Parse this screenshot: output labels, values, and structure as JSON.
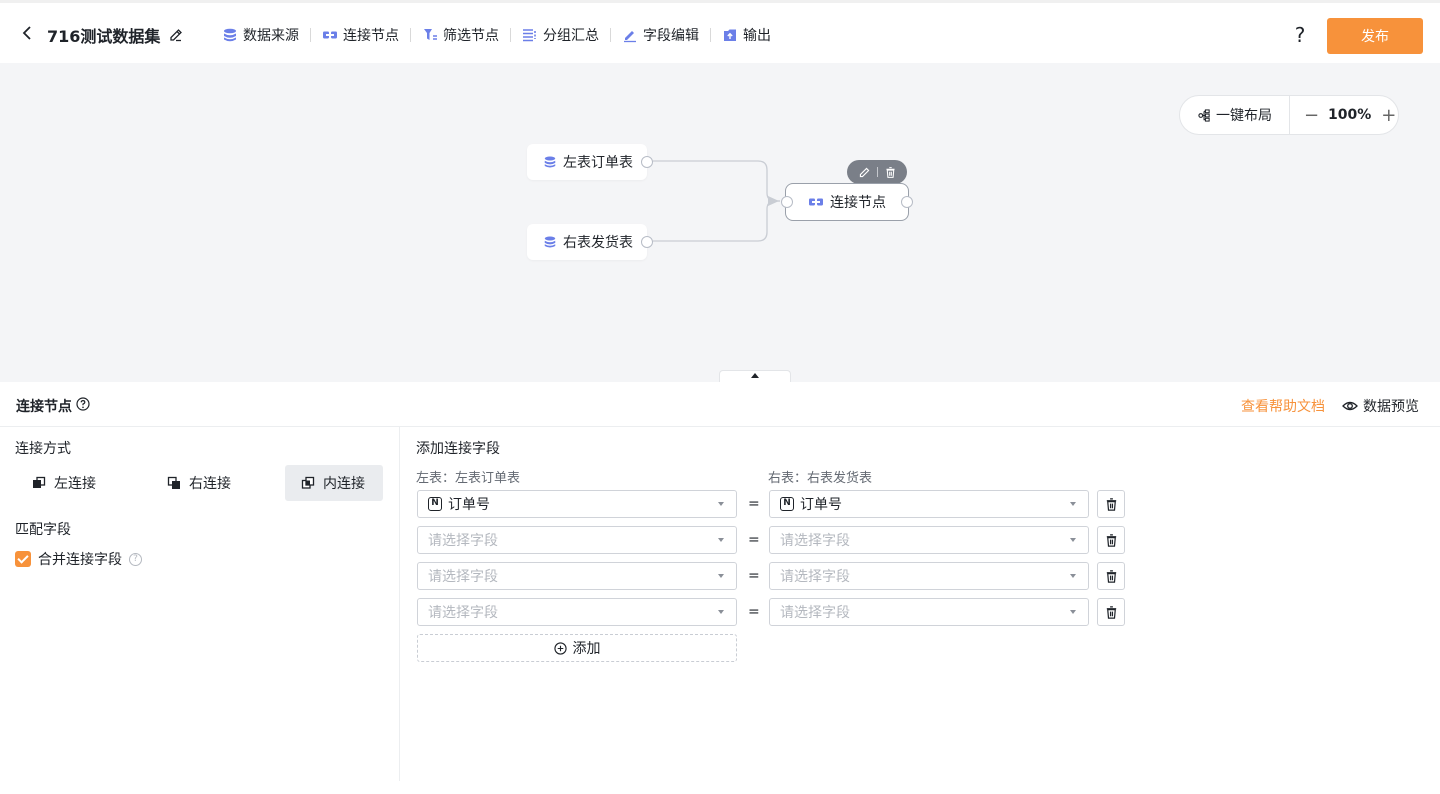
{
  "header": {
    "title": "716测试数据集",
    "tools": [
      {
        "label": "数据来源",
        "icon": "database-icon"
      },
      {
        "label": "连接节点",
        "icon": "join-icon"
      },
      {
        "label": "筛选节点",
        "icon": "filter-icon"
      },
      {
        "label": "分组汇总",
        "icon": "group-icon"
      },
      {
        "label": "字段编辑",
        "icon": "pen-icon"
      },
      {
        "label": "输出",
        "icon": "output-icon"
      }
    ],
    "help": "?",
    "publish_label": "发布"
  },
  "canvas": {
    "layout_label": "一键布局",
    "zoom_minus": "−",
    "zoom_level": "100%",
    "zoom_plus": "+",
    "nodes": {
      "left": "左表订单表",
      "right": "右表发货表",
      "join": "连接节点"
    }
  },
  "panel": {
    "title": "连接节点",
    "help_link": "查看帮助文档",
    "preview_label": "数据预览",
    "join_method_label": "连接方式",
    "join_types": [
      "左连接",
      "右连接",
      "内连接"
    ],
    "active_join": "内连接",
    "match_label": "匹配字段",
    "merge_checkbox_label": "合并连接字段",
    "merge_checked": true,
    "add_fields_label": "添加连接字段",
    "left_table_label": "左表：左表订单表",
    "right_table_label": "右表：右表发货表",
    "placeholder": "请选择字段",
    "rows": [
      {
        "left": "订单号",
        "right": "订单号"
      },
      {
        "left": "",
        "right": ""
      },
      {
        "left": "",
        "right": ""
      },
      {
        "left": "",
        "right": ""
      }
    ],
    "equals": "=",
    "field_type_glyph": "N",
    "add_label": "添加"
  },
  "colors": {
    "accent": "#f7923b",
    "canvas_bg": "#f4f5f7",
    "icon_blue": "#6b7fe8"
  }
}
